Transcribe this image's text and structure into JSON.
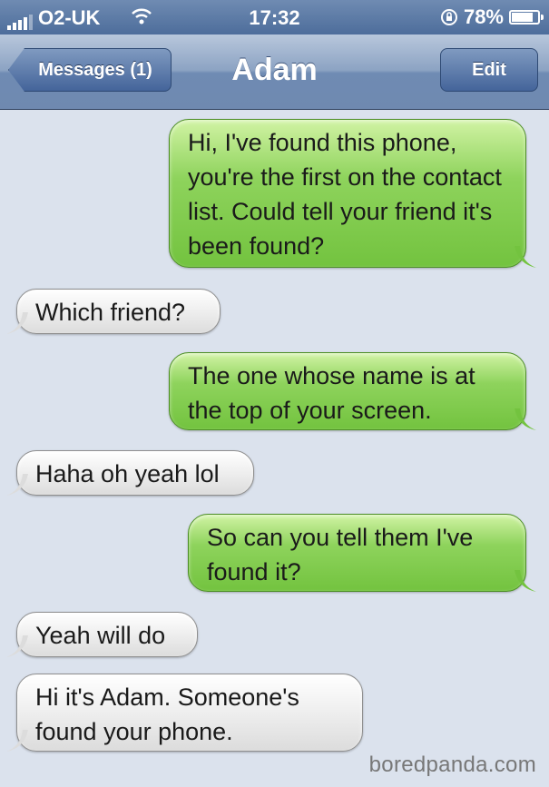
{
  "status_bar": {
    "carrier": "O2-UK",
    "time": "17:32",
    "battery": "78%",
    "battery_level": 0.78,
    "icons": [
      "signal-icon",
      "wifi-icon",
      "rotation-lock-icon",
      "battery-icon"
    ]
  },
  "nav": {
    "back_label": "Messages (1)",
    "title": "Adam",
    "edit_label": "Edit"
  },
  "messages": [
    {
      "direction": "sent",
      "text": "Hi, I've found this phone, you're the first on the contact list. Could tell your friend it's been found?"
    },
    {
      "direction": "received",
      "text": "Which friend?"
    },
    {
      "direction": "sent",
      "text": "The one whose name is at the top of your screen."
    },
    {
      "direction": "received",
      "text": "Haha oh yeah lol"
    },
    {
      "direction": "sent",
      "text": "So can you tell them I've found it?"
    },
    {
      "direction": "received",
      "text": "Yeah will do"
    },
    {
      "direction": "received",
      "text": "Hi it's Adam. Someone's found your phone."
    }
  ],
  "watermark": "boredpanda.com",
  "colors": {
    "sent_bubble": "#8ed35c",
    "received_bubble": "#f0f0f0",
    "nav_bar": "#6f8bb3",
    "background": "#dbe2ed"
  }
}
